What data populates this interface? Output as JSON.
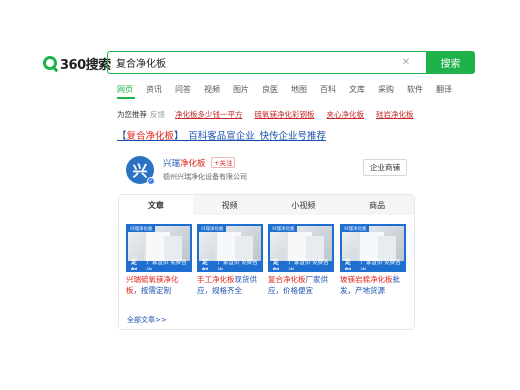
{
  "header": {
    "logo_text": "360搜索",
    "search_value": "复合净化板",
    "clear_icon": "close-icon",
    "search_button": "搜索"
  },
  "nav": [
    "网页",
    "资讯",
    "问答",
    "视频",
    "图片",
    "良医",
    "地图",
    "百科",
    "文库",
    "采购",
    "软件",
    "翻译"
  ],
  "suggest": {
    "label": "为您推荐",
    "feedback": "反馈",
    "items": [
      "净化板多少钱一平方",
      "硫氧镁净化彩钢板",
      "夹心净化板",
      "硅岩净化板"
    ]
  },
  "result": {
    "title_prefix": "【",
    "title_keyword": "复合净化板",
    "title_suffix": "】_百科客品宣企业_快传企业号推荐"
  },
  "company": {
    "logo_glyph": "兴",
    "name_prefix": "兴瑞",
    "name_keyword": "净化板",
    "follow": "+关注",
    "sub": "德州兴瑞净化设备有限公司",
    "shop_button": "企业商铺"
  },
  "card": {
    "tabs": [
      "文章",
      "视频",
      "小视频",
      "商品"
    ],
    "items": [
      {
        "tag": "兴瑞净化板",
        "bar_main": "定制",
        "bar_sub": "厂家直供 免费咨询",
        "caption_kw": "兴瑞硫氧镁净化板",
        "caption_rest": "，按需定制"
      },
      {
        "tag": "兴瑞净化板",
        "bar_main": "定制",
        "bar_sub": "厂家直供 免费咨询",
        "caption_kw": "手工净化板",
        "caption_rest": "现货供应，规格齐全"
      },
      {
        "tag": "兴瑞净化板",
        "bar_main": "定制",
        "bar_sub": "厂家直供 免费咨询",
        "caption_kw": "复合净化板",
        "caption_rest": "厂家供应，价格便宜"
      },
      {
        "tag": "兴瑞净化板",
        "bar_main": "定制",
        "bar_sub": "厂家直供 免费咨询",
        "caption_kw": "玻镁岩棉净化板",
        "caption_rest": "批发，产地货源"
      }
    ],
    "all_link": "全部文章>>"
  }
}
